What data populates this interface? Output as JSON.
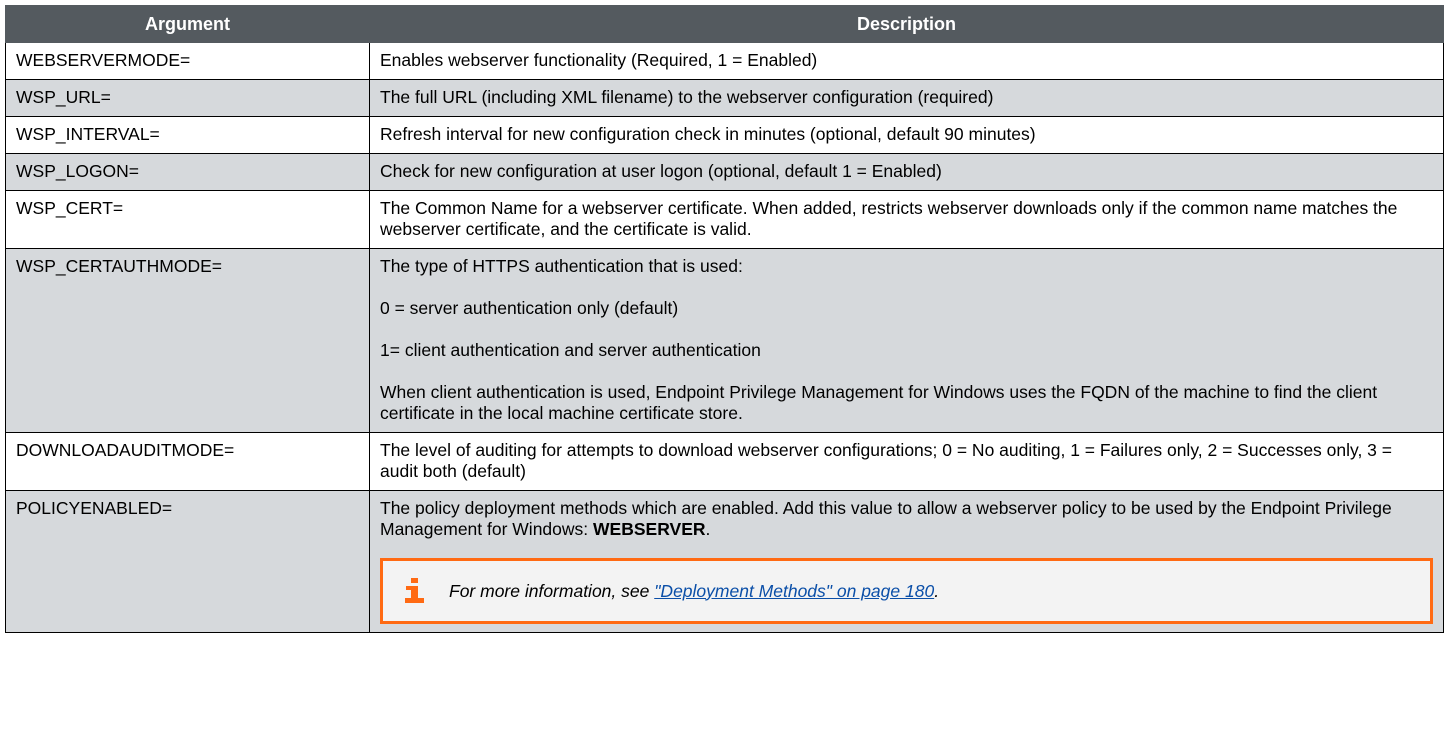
{
  "table": {
    "headers": [
      "Argument",
      "Description"
    ],
    "rows": [
      {
        "argument": "WEBSERVERMODE=",
        "description": [
          "Enables webserver functionality (Required, 1 = Enabled)"
        ]
      },
      {
        "argument": "WSP_URL=",
        "description": [
          "The full URL (including XML filename) to the webserver configuration (required)"
        ]
      },
      {
        "argument": "WSP_INTERVAL=",
        "description": [
          "Refresh interval for new configuration check in minutes (optional, default 90 minutes)"
        ]
      },
      {
        "argument": "WSP_LOGON=",
        "description": [
          "Check for new configuration at user logon (optional, default 1 = Enabled)"
        ]
      },
      {
        "argument": "WSP_CERT=",
        "description": [
          "The Common Name for a webserver certificate. When added, restricts webserver downloads only if the common name matches the webserver certificate, and the certificate is valid."
        ]
      },
      {
        "argument": "WSP_CERTAUTHMODE=",
        "description": [
          "The type of HTTPS authentication that is used:",
          "0 = server authentication only (default)",
          "1= client authentication and server authentication",
          "When client authentication is used, Endpoint Privilege Management for Windows uses the FQDN of the machine to find the client certificate in the local machine certificate store."
        ]
      },
      {
        "argument": "DOWNLOADAUDITMODE=",
        "description": [
          "The level of auditing for attempts to download webserver configurations; 0 = No auditing, 1 = Failures only, 2 = Successes only, 3 = audit both (default)"
        ]
      },
      {
        "argument": "POLICYENABLED=",
        "description": [
          "The policy deployment methods which are enabled. Add this value to allow a webserver policy to be used by the Endpoint Privilege Management for Windows:",
          "WEBSERVER",
          "."
        ]
      }
    ],
    "note": {
      "icon": "info-icon",
      "prefix": "For more information, see ",
      "link_text": "\"Deployment Methods\" on page 180",
      "suffix": "."
    }
  },
  "colors": {
    "header_bg": "#545a5f",
    "row_alt_bg": "#d6d9dc",
    "note_border": "#ff6a13",
    "link": "#0b4fa8"
  }
}
